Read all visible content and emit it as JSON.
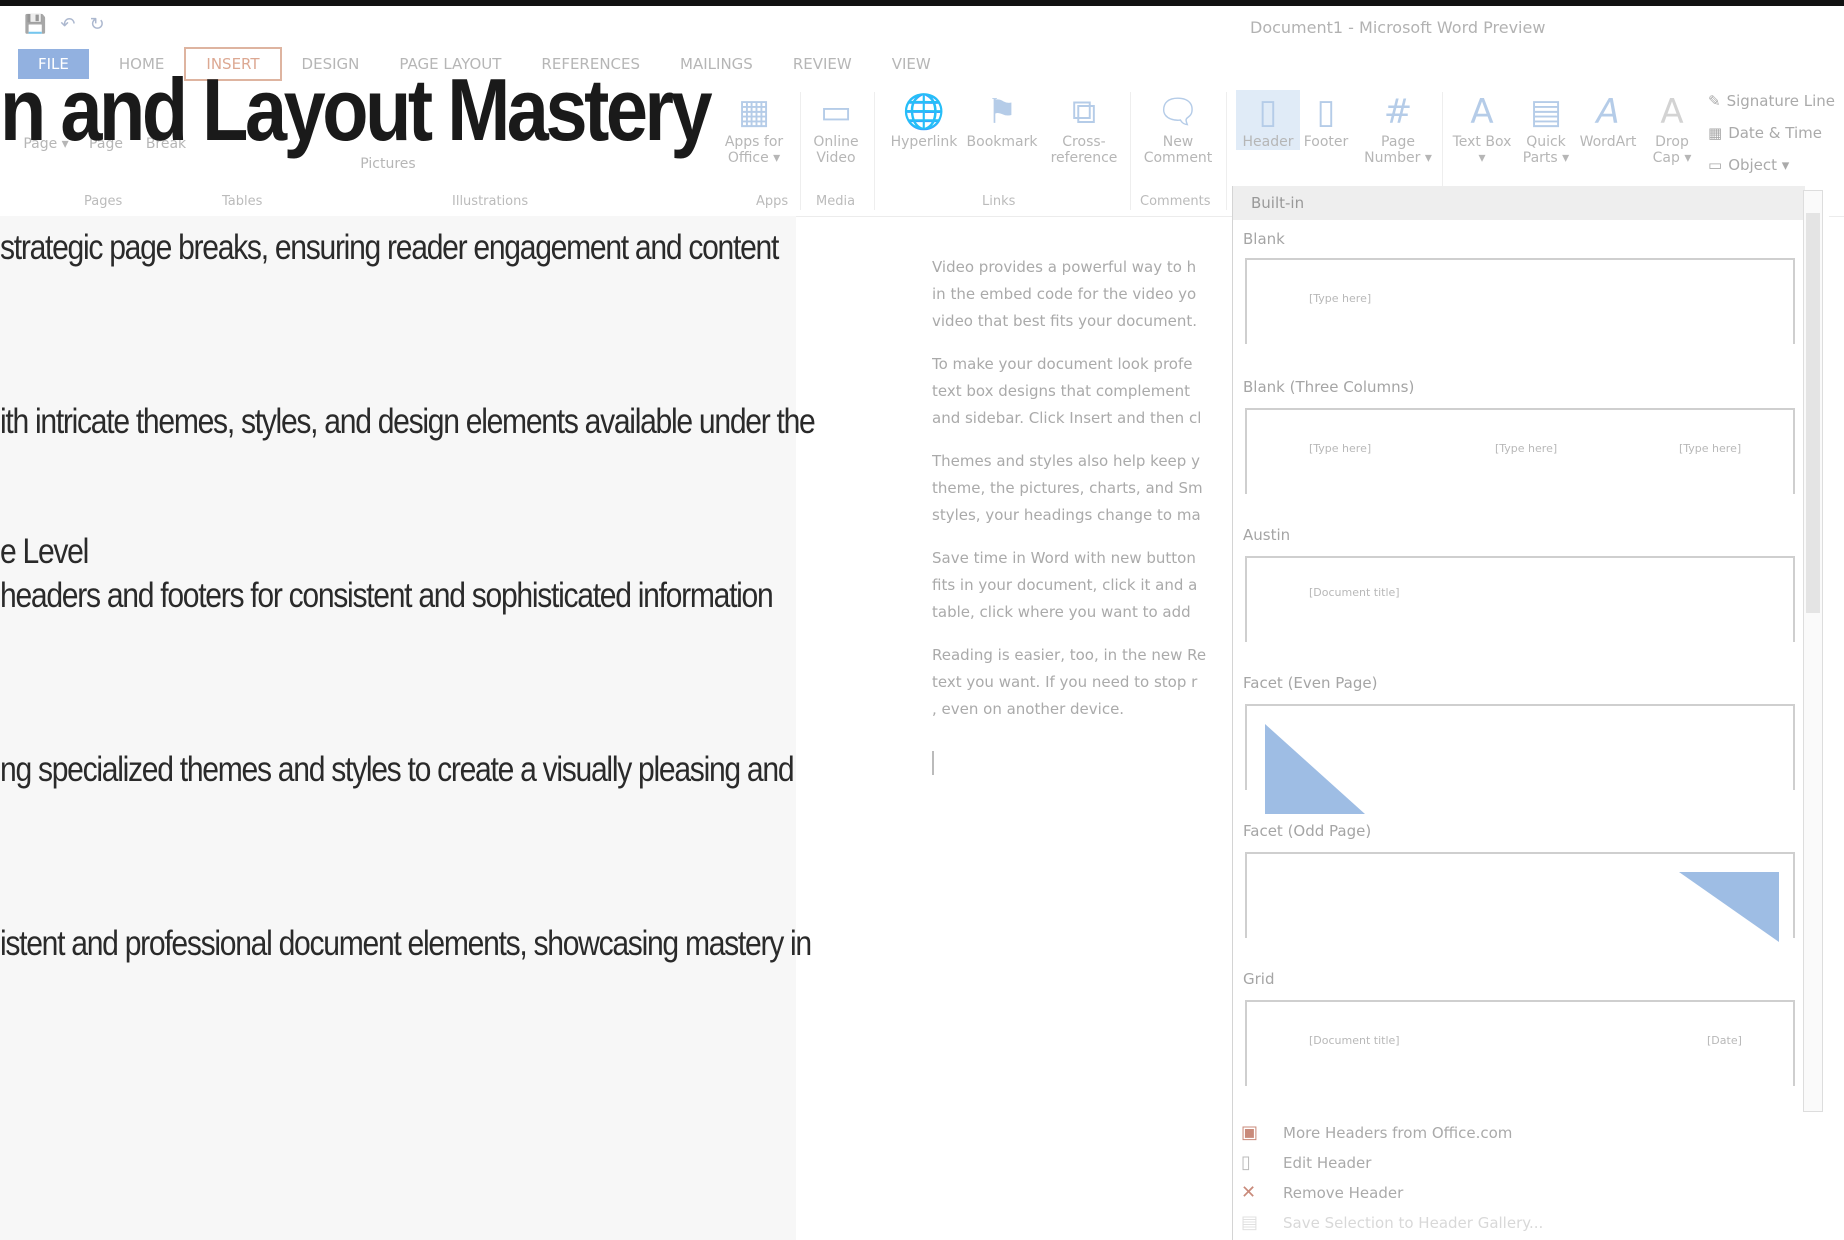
{
  "slide": {
    "title": "n and Layout Mastery",
    "bullets": [
      "strategic page breaks, ensuring reader engagement and content",
      "ith intricate themes, styles, and design elements available under the",
      "e Level",
      " headers and footers for consistent and sophisticated information",
      "ng specialized themes and styles to create a visually pleasing and",
      "istent and professional document elements, showcasing mastery in"
    ]
  },
  "word": {
    "window_title": "Document1 - Microsoft Word Preview",
    "quick_access": {
      "save": "💾",
      "undo": "↶",
      "redo": "↻"
    },
    "tabs": [
      "FILE",
      "HOME",
      "INSERT",
      "DESIGN",
      "PAGE LAYOUT",
      "REFERENCES",
      "MAILINGS",
      "REVIEW",
      "VIEW"
    ],
    "active_tab": "INSERT",
    "ribbon": {
      "left_labels": {
        "pages": "Pages",
        "page": "Page ▾",
        "page2": "Page",
        "break": "Break",
        "tables": "Tables",
        "pictures": "Pictures",
        "illustrations": "Illustrations"
      },
      "buttons": {
        "apps": "Apps for Office ▾",
        "online_video": "Online Video",
        "hyperlink": "Hyperlink",
        "bookmark": "Bookmark",
        "cross_ref": "Cross-reference",
        "new_comment": "New Comment",
        "header": "Header",
        "footer": "Footer",
        "page_number": "Page Number ▾",
        "text_box": "Text Box ▾",
        "quick_parts": "Quick Parts ▾",
        "wordart": "WordArt",
        "drop_cap": "Drop Cap ▾"
      },
      "groups": {
        "apps": "Apps",
        "media": "Media",
        "links": "Links",
        "comments": "Comments"
      },
      "small": {
        "signature": "Signature Line",
        "datetime": "Date & Time",
        "object": "Object ▾"
      }
    },
    "document_paragraphs": [
      "Video provides a powerful way to h",
      "in the embed code for the video yo",
      "video that best fits your document.",
      "To make your document look profe",
      "text box designs that complement",
      "and sidebar. Click Insert and then cl",
      "Themes and styles also help keep y",
      "theme, the pictures, charts, and Sm",
      "styles, your headings change to ma",
      "Save time in Word with new button",
      "fits in your document, click it and a",
      "table, click where you want to add",
      "Reading is easier, too, in the new Re",
      "text you want. If you need to stop r",
      ", even on another device."
    ],
    "gallery": {
      "section": "Built-in",
      "items": [
        {
          "name": "Blank",
          "placeholders": [
            "[Type here]"
          ]
        },
        {
          "name": "Blank (Three Columns)",
          "placeholders": [
            "[Type here]",
            "[Type here]",
            "[Type here]"
          ]
        },
        {
          "name": "Austin",
          "placeholders": [
            "[Document title]"
          ]
        },
        {
          "name": "Facet (Even Page)",
          "placeholders": []
        },
        {
          "name": "Facet (Odd Page)",
          "placeholders": []
        },
        {
          "name": "Grid",
          "placeholders": [
            "[Document title]",
            "[Date]"
          ]
        }
      ],
      "menu": [
        "More Headers from Office.com",
        "Edit Header",
        "Remove Header",
        "Save Selection to Header Gallery..."
      ]
    }
  },
  "colors": {
    "accent": "#3a73c7",
    "thumb_shape": "#9ebde4",
    "active_tab_border": "#d9a890"
  }
}
